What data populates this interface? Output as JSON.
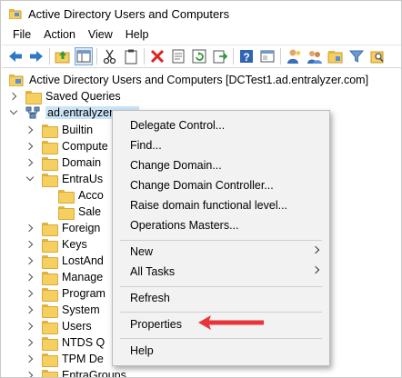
{
  "window": {
    "title": "Active Directory Users and Computers"
  },
  "menubar": {
    "items": [
      "File",
      "Action",
      "View",
      "Help"
    ]
  },
  "toolbar": {
    "icons": [
      "back-icon",
      "forward-icon",
      "up-icon",
      "show-tree-icon",
      "cut-icon",
      "clipboard-icon",
      "delete-icon",
      "properties-icon",
      "refresh-icon",
      "export-icon",
      "help-icon",
      "console-icon",
      "new-user-icon",
      "new-group-icon",
      "new-ou-icon",
      "filter-icon",
      "find-icon"
    ]
  },
  "tree": {
    "root": "Active Directory Users and Computers [DCTest1.ad.entralyzer.com]",
    "saved_queries": "Saved Queries",
    "domain": "ad.entralyzer.com",
    "children": [
      "Builtin",
      "Compute",
      "Domain",
      "EntraUs",
      "Acco",
      "Sale",
      "Foreign",
      "Keys",
      "LostAnd",
      "Manage",
      "Program",
      "System",
      "Users",
      "NTDS Q",
      "TPM De",
      "EntraGroups"
    ]
  },
  "context_menu": {
    "items": [
      "Delegate Control...",
      "Find...",
      "Change Domain...",
      "Change Domain Controller...",
      "Raise domain functional level...",
      "Operations Masters...",
      "New",
      "All Tasks",
      "Refresh",
      "Properties",
      "Help"
    ]
  },
  "colors": {
    "callout_arrow": "#e8343a",
    "selection": "#cce4f7",
    "folder": "#f5cf5f"
  }
}
